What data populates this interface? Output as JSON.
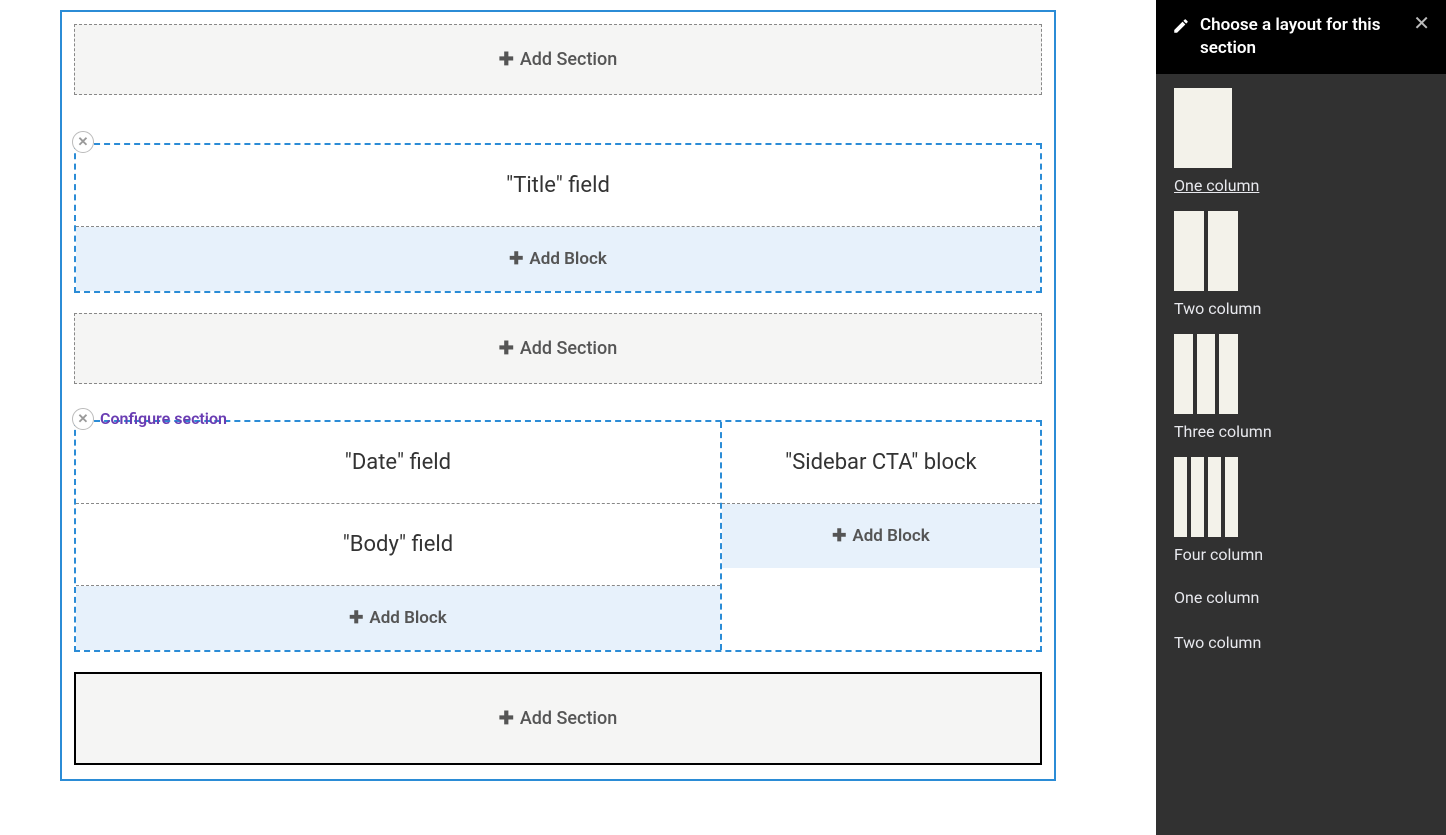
{
  "buttons": {
    "add_section": "Add Section",
    "add_block": "Add Block"
  },
  "configure_section": "Configure section",
  "sections": {
    "s1": {
      "title_block": "\"Title\" field"
    },
    "s2": {
      "date_block": "\"Date\" field",
      "body_block": "\"Body\" field",
      "sidebar_cta_block": "\"Sidebar CTA\" block"
    }
  },
  "panel": {
    "title": "Choose a layout for this section",
    "options": {
      "one": "One column",
      "two": "Two column",
      "three": "Three column",
      "four": "Four column",
      "one_text": "One column",
      "two_text": "Two column"
    }
  }
}
